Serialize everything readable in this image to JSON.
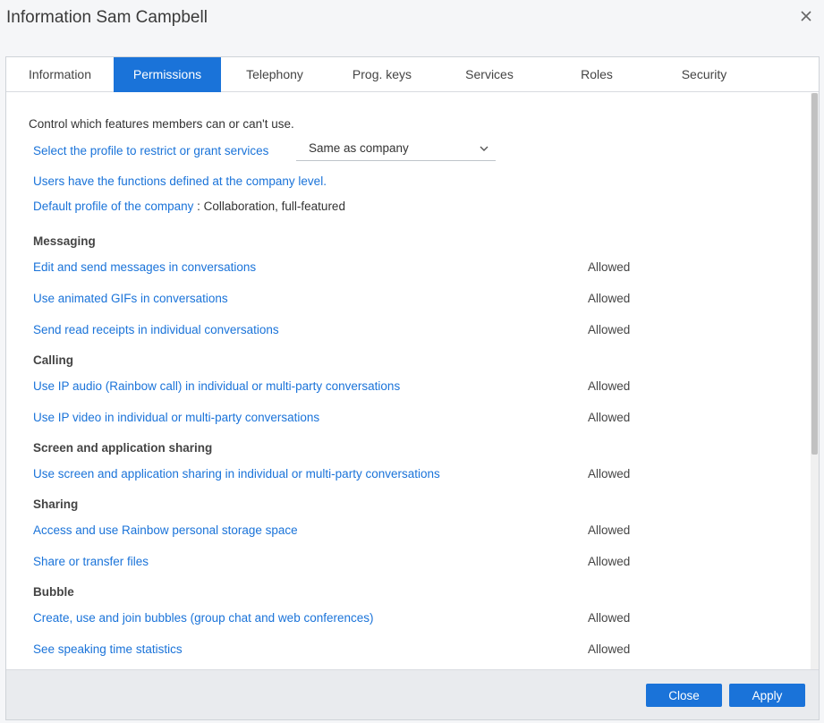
{
  "dialog": {
    "title": "Information Sam Campbell",
    "close_icon": "close-icon"
  },
  "tabs": [
    {
      "label": "Information",
      "active": false
    },
    {
      "label": "Permissions",
      "active": true
    },
    {
      "label": "Telephony",
      "active": false
    },
    {
      "label": "Prog. keys",
      "active": false
    },
    {
      "label": "Services",
      "active": false
    },
    {
      "label": "Roles",
      "active": false
    },
    {
      "label": "Security",
      "active": false
    }
  ],
  "permissions": {
    "intro": "Control which features members can or can't use.",
    "profile_label": "Select the profile to restrict or grant services",
    "profile_value": "Same as company",
    "notice": "Users have the functions defined at the company level.",
    "default_label": "Default profile of the company",
    "default_value": " : Collaboration, full-featured",
    "sections": [
      {
        "title": "Messaging",
        "items": [
          {
            "label": "Edit and send messages in conversations",
            "status": "Allowed"
          },
          {
            "label": "Use animated GIFs in conversations",
            "status": "Allowed"
          },
          {
            "label": "Send read receipts in individual conversations",
            "status": "Allowed"
          }
        ]
      },
      {
        "title": "Calling",
        "items": [
          {
            "label": "Use IP audio (Rainbow call) in individual or multi-party conversations",
            "status": "Allowed"
          },
          {
            "label": "Use IP video in individual or multi-party conversations",
            "status": "Allowed"
          }
        ]
      },
      {
        "title": "Screen and application sharing",
        "items": [
          {
            "label": "Use screen and application sharing in individual or multi-party conversations",
            "status": "Allowed"
          }
        ]
      },
      {
        "title": "Sharing",
        "items": [
          {
            "label": "Access and use Rainbow personal storage space",
            "status": "Allowed"
          },
          {
            "label": "Share or transfer files",
            "status": "Allowed"
          }
        ]
      },
      {
        "title": "Bubble",
        "items": [
          {
            "label": "Create, use and join bubbles (group chat and web conferences)",
            "status": "Allowed"
          },
          {
            "label": "See speaking time statistics",
            "status": "Allowed"
          }
        ]
      }
    ]
  },
  "footer": {
    "close_label": "Close",
    "apply_label": "Apply"
  },
  "colors": {
    "accent": "#1a73d9"
  }
}
